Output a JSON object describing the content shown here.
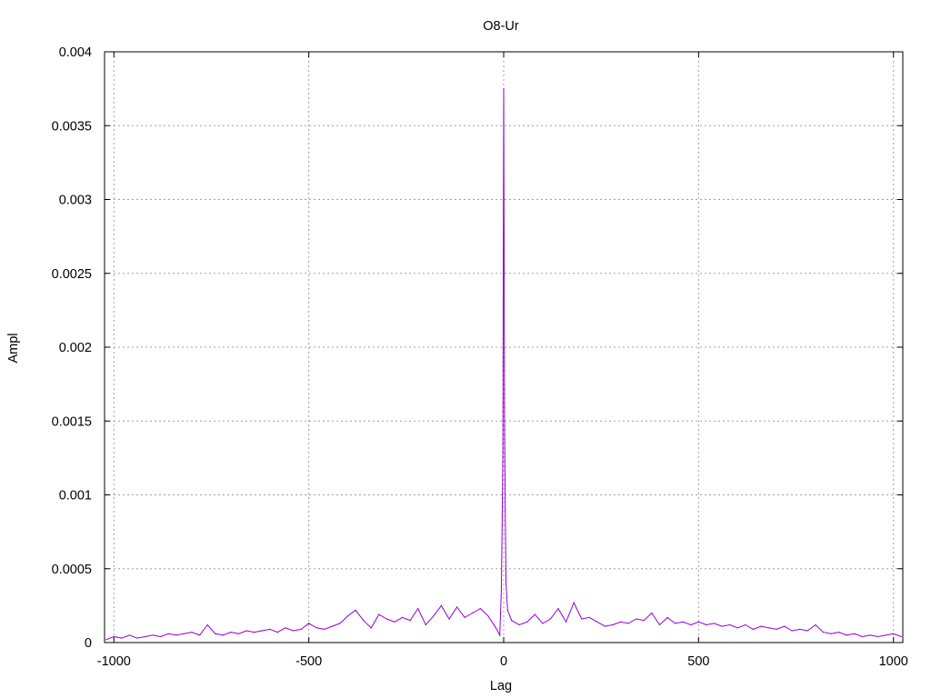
{
  "chart_data": {
    "type": "line",
    "title": "O8-Ur",
    "xlabel": "Lag",
    "ylabel": "Ampl",
    "xlim": [
      -1024,
      1024
    ],
    "ylim": [
      0,
      0.004
    ],
    "grid": true,
    "x_ticks": [
      {
        "value": -1000,
        "label": "-1000"
      },
      {
        "value": -500,
        "label": "-500"
      },
      {
        "value": 0,
        "label": "0"
      },
      {
        "value": 500,
        "label": "500"
      },
      {
        "value": 1000,
        "label": "1000"
      }
    ],
    "y_ticks": [
      {
        "value": 0,
        "label": "0"
      },
      {
        "value": 0.0005,
        "label": "0.0005"
      },
      {
        "value": 0.001,
        "label": "0.001"
      },
      {
        "value": 0.0015,
        "label": "0.0015"
      },
      {
        "value": 0.002,
        "label": "0.002"
      },
      {
        "value": 0.0025,
        "label": "0.0025"
      },
      {
        "value": 0.003,
        "label": "0.003"
      },
      {
        "value": 0.0035,
        "label": "0.0035"
      },
      {
        "value": 0.004,
        "label": "0.004"
      }
    ],
    "series": [
      {
        "color": "#9400d3",
        "x": [
          -1020,
          -1000,
          -980,
          -960,
          -940,
          -920,
          -900,
          -880,
          -860,
          -840,
          -820,
          -800,
          -780,
          -760,
          -740,
          -720,
          -700,
          -680,
          -660,
          -640,
          -620,
          -600,
          -580,
          -560,
          -540,
          -520,
          -500,
          -480,
          -460,
          -440,
          -420,
          -400,
          -380,
          -360,
          -340,
          -320,
          -300,
          -280,
          -260,
          -240,
          -220,
          -200,
          -180,
          -160,
          -140,
          -120,
          -100,
          -80,
          -60,
          -40,
          -20,
          -10,
          -6,
          -4,
          -2,
          -1,
          0,
          1,
          2,
          4,
          6,
          10,
          20,
          40,
          60,
          80,
          100,
          120,
          140,
          160,
          180,
          200,
          220,
          240,
          260,
          280,
          300,
          320,
          340,
          360,
          380,
          400,
          420,
          440,
          460,
          480,
          500,
          520,
          540,
          560,
          580,
          600,
          620,
          640,
          660,
          680,
          700,
          720,
          740,
          760,
          780,
          800,
          820,
          840,
          860,
          880,
          900,
          920,
          940,
          960,
          980,
          1000,
          1020
        ],
        "y": [
          2e-05,
          4e-05,
          3e-05,
          5e-05,
          3e-05,
          4e-05,
          5e-05,
          4e-05,
          6e-05,
          5e-05,
          6e-05,
          7e-05,
          5e-05,
          0.00012,
          6e-05,
          5e-05,
          7e-05,
          6e-05,
          8e-05,
          7e-05,
          8e-05,
          9e-05,
          7e-05,
          0.0001,
          8e-05,
          9e-05,
          0.00013,
          0.0001,
          9e-05,
          0.00011,
          0.00013,
          0.00018,
          0.00022,
          0.00015,
          0.0001,
          0.00019,
          0.00016,
          0.00014,
          0.00017,
          0.00015,
          0.00023,
          0.00012,
          0.00018,
          0.00025,
          0.00016,
          0.00024,
          0.00017,
          0.0002,
          0.00023,
          0.00018,
          0.0001,
          5e-05,
          0.00035,
          0.0008,
          0.0013,
          0.00265,
          0.00375,
          0.00285,
          0.0016,
          0.0009,
          0.0004,
          0.00022,
          0.00015,
          0.00012,
          0.00014,
          0.00019,
          0.00013,
          0.00016,
          0.00023,
          0.00014,
          0.00027,
          0.00016,
          0.00017,
          0.00014,
          0.00011,
          0.00012,
          0.00014,
          0.00013,
          0.00016,
          0.00015,
          0.0002,
          0.00012,
          0.00017,
          0.00013,
          0.00014,
          0.00012,
          0.00014,
          0.00012,
          0.00013,
          0.00011,
          0.00012,
          0.0001,
          0.00012,
          9e-05,
          0.00011,
          0.0001,
          9e-05,
          0.00011,
          8e-05,
          9e-05,
          8e-05,
          0.00012,
          7e-05,
          6e-05,
          7e-05,
          5e-05,
          6e-05,
          4e-05,
          5e-05,
          4e-05,
          5e-05,
          6e-05,
          4e-05
        ]
      }
    ]
  }
}
